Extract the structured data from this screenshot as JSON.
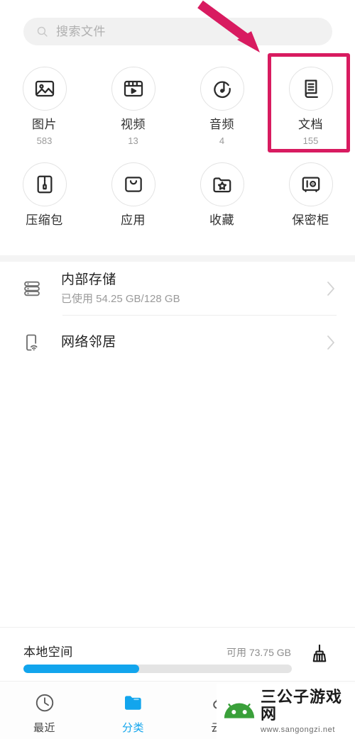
{
  "search": {
    "placeholder": "搜索文件",
    "icon": "search-icon"
  },
  "categories": [
    {
      "label": "图片",
      "count": "583",
      "icon": "image-icon"
    },
    {
      "label": "视频",
      "count": "13",
      "icon": "video-icon"
    },
    {
      "label": "音频",
      "count": "4",
      "icon": "audio-icon"
    },
    {
      "label": "文档",
      "count": "155",
      "icon": "document-icon",
      "highlighted": true
    },
    {
      "label": "压缩包",
      "count": "",
      "icon": "archive-icon"
    },
    {
      "label": "应用",
      "count": "",
      "icon": "app-bag-icon"
    },
    {
      "label": "收藏",
      "count": "",
      "icon": "favorite-folder-icon"
    },
    {
      "label": "保密柜",
      "count": "",
      "icon": "safe-vault-icon"
    }
  ],
  "storage_list": [
    {
      "title": "内部存储",
      "subtitle": "已使用 54.25 GB/128 GB",
      "icon": "storage-stack-icon",
      "chevron": "chevron-right-icon"
    },
    {
      "title": "网络邻居",
      "subtitle": "",
      "icon": "network-phone-wifi-icon",
      "chevron": "chevron-right-icon"
    }
  ],
  "local_space": {
    "title": "本地空间",
    "free_label": "可用 73.75 GB",
    "progress_percent": 43,
    "bar_color": "#12a5ed",
    "cleanup_icon": "broom-icon"
  },
  "bottom_nav": [
    {
      "label": "最近",
      "icon": "clock-icon",
      "active": false
    },
    {
      "label": "分类",
      "icon": "folder-icon",
      "active": true
    },
    {
      "label": "云盘",
      "icon": "cloud-icon",
      "active": false
    },
    {
      "label": "",
      "icon": "person-icon",
      "active": false
    }
  ],
  "annotation": {
    "arrow_color": "#d81b60",
    "highlight_color": "#d81b60",
    "arrow_name": "pink-pointer-arrow",
    "highlight_target": "文档"
  },
  "watermark": {
    "title": "三公子游戏网",
    "url": "www.sangongzi.net",
    "logo_color": "#3aa03a"
  }
}
